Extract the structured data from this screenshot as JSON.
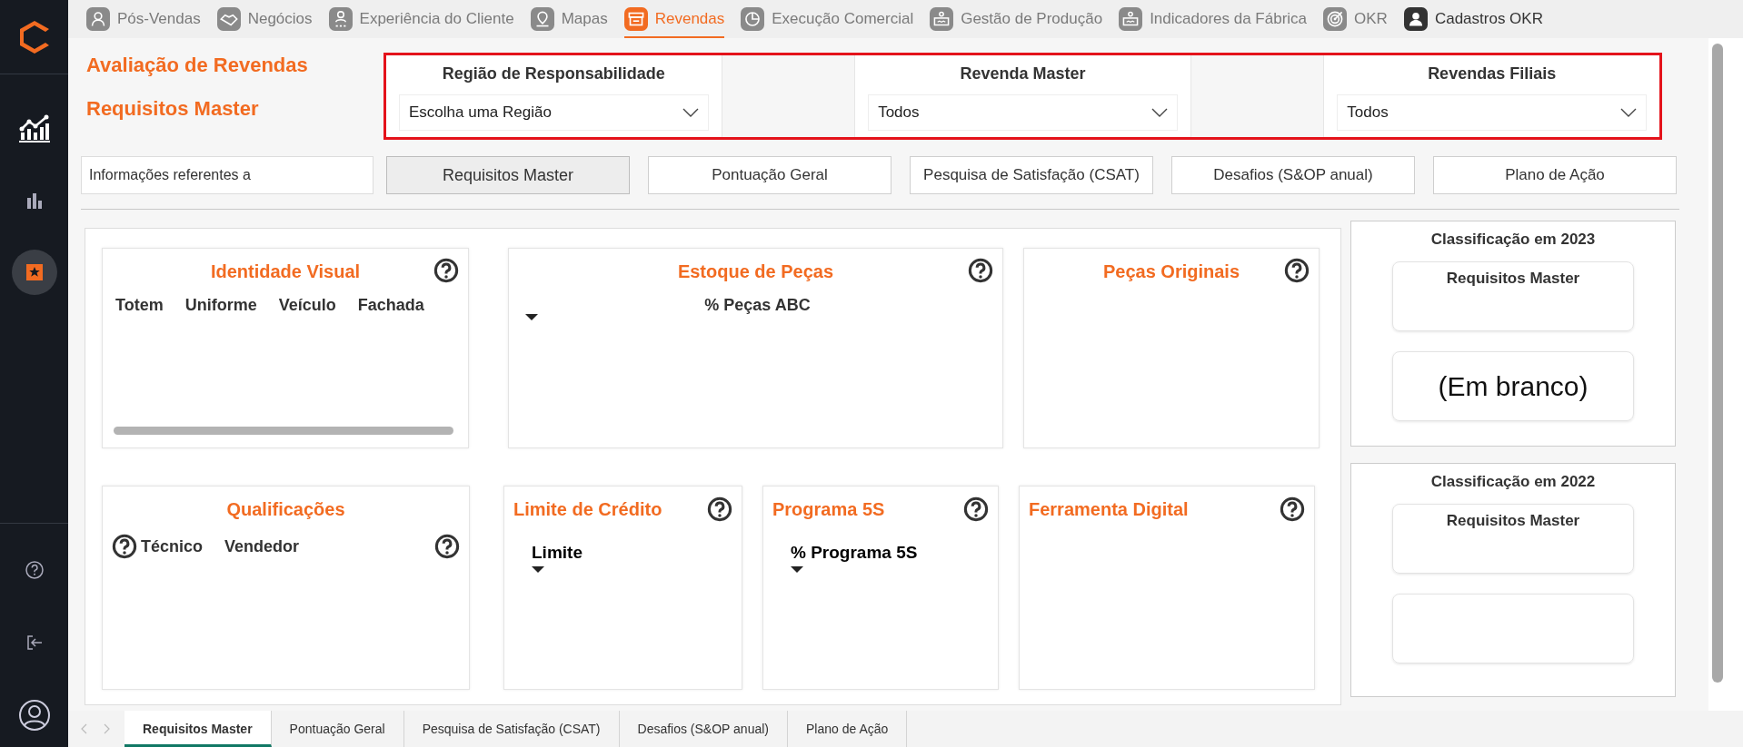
{
  "nav": {
    "items": [
      {
        "label": "Pós-Vendas",
        "kind": "module",
        "selected": false
      },
      {
        "label": "Negócios",
        "kind": "module",
        "selected": false
      },
      {
        "label": "Experiência do Cliente",
        "kind": "module",
        "selected": false
      },
      {
        "label": "Mapas",
        "kind": "module",
        "selected": false
      },
      {
        "label": "Revendas",
        "kind": "module",
        "selected": true
      },
      {
        "label": "Execução Comercial",
        "kind": "module",
        "selected": false
      },
      {
        "label": "Gestão de Produção",
        "kind": "module",
        "selected": false
      },
      {
        "label": "Indicadores da Fábrica",
        "kind": "module",
        "selected": false
      },
      {
        "label": "OKR",
        "kind": "module",
        "selected": false
      },
      {
        "label": "Cadastros OKR",
        "kind": "account",
        "selected": false
      }
    ]
  },
  "sidebar": {
    "items": [
      {
        "kind": "trend",
        "selected": false
      },
      {
        "kind": "bars",
        "selected": false
      },
      {
        "kind": "star",
        "selected": true
      }
    ],
    "bottom_items": [
      {
        "kind": "help"
      },
      {
        "kind": "logout"
      },
      {
        "kind": "account"
      }
    ]
  },
  "header": {
    "title": "Avaliação de Revendas",
    "subtitle": "Requisitos Master"
  },
  "filters": [
    {
      "label": "Região de Responsabilidade",
      "value": "Escolha uma Região"
    },
    {
      "label": "Revenda Master",
      "value": "Todos"
    },
    {
      "label": "Revendas Filiais",
      "value": "Todos"
    }
  ],
  "info_field": {
    "value": "Informações referentes a"
  },
  "page_buttons": [
    {
      "label": "Requisitos Master",
      "selected": true
    },
    {
      "label": "Pontuação Geral",
      "selected": false
    },
    {
      "label": "Pesquisa de Satisfação (CSAT)",
      "selected": false
    },
    {
      "label": "Desafios (S&OP anual)",
      "selected": false
    },
    {
      "label": "Plano de Ação",
      "selected": false
    }
  ],
  "visual_rows": [
    {
      "visuals": [
        {
          "kind": "scrolled",
          "title": "Identidade Visual",
          "headers": [
            "Totem",
            "Uniforme",
            "Veículo",
            "Fachada"
          ]
        },
        {
          "kind": "sorted",
          "title": "Estoque de Peças",
          "headers": [
            "% Peças ABC"
          ]
        },
        {
          "kind": "empty",
          "title": "Peças Originais"
        }
      ]
    },
    {
      "visuals": [
        {
          "kind": "crowded",
          "title": "Qualificações",
          "headers": [
            "Técnico",
            "Vendedor"
          ]
        },
        {
          "kind": "measure",
          "title": "Limite de Crédito",
          "headers": [
            "Limite"
          ]
        },
        {
          "kind": "measure",
          "title": "Programa 5S",
          "headers": [
            "% Programa 5S"
          ]
        },
        {
          "kind": "plain",
          "title": "Ferramenta Digital"
        }
      ]
    }
  ],
  "ranking_cards": [
    {
      "title": "Classificação em 2023",
      "label": "Requisitos Master",
      "value": "(Em branco)"
    },
    {
      "title": "Classificação em 2022",
      "label": "Requisitos Master"
    }
  ],
  "report_tabs": [
    {
      "label": "Requisitos Master",
      "selected": true
    },
    {
      "label": "Pontuação Geral",
      "selected": false
    },
    {
      "label": "Pesquisa de Satisfação (CSAT)",
      "selected": false
    },
    {
      "label": "Desafios (S&OP anual)",
      "selected": false
    },
    {
      "label": "Plano de Ação",
      "selected": false
    }
  ]
}
